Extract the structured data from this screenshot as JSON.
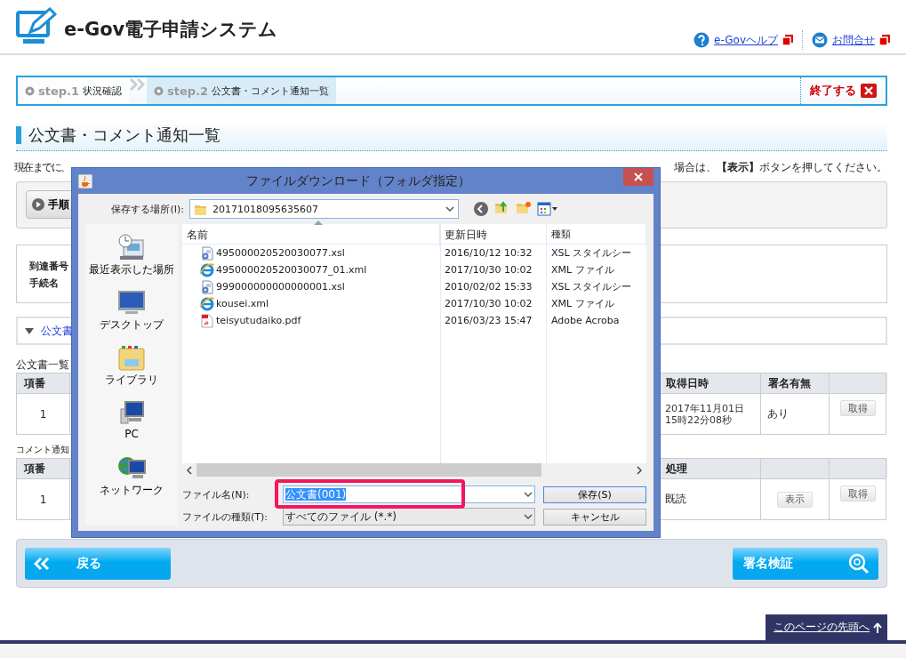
{
  "header": {
    "title": "e-Gov電子申請システム",
    "links": [
      {
        "label": "e-Govヘルプ",
        "kind": "help"
      },
      {
        "label": "お問合せ",
        "kind": "mail"
      }
    ]
  },
  "steps": [
    {
      "step": "step.1",
      "label": "状況確認",
      "selected": false
    },
    {
      "step": "step.2",
      "label": "公文書・コメント通知一覧",
      "selected": true
    }
  ],
  "exit_button": "終了する",
  "heading": "公文書・コメント通知一覧",
  "instruction": {
    "start": "現在までに、",
    "end": "場合は、**【表示】**ボタンを押してください。"
  },
  "procedure_button": "手順",
  "info_labels": [
    "到達番号",
    "手続名"
  ],
  "section_link": "公文書",
  "documents": {
    "caption": "公文書一覧",
    "columns": [
      "項番",
      "取得日時",
      "署名有無"
    ],
    "rows": [
      {
        "index": "1",
        "acquired": [
          "2017年11月01日",
          "15時22分08秒"
        ],
        "signed": "あり",
        "action": "取得"
      }
    ]
  },
  "comments": {
    "caption": "コメント通知",
    "columns": [
      "項番",
      "処理"
    ],
    "rows": [
      {
        "index": "1",
        "status": "既読",
        "view": "表示",
        "action": "取得"
      }
    ]
  },
  "back_button": "戻る",
  "verify_button": "署名検証",
  "page_top": "このページの先頭へ",
  "dialog": {
    "title": "ファイルダウンロード（フォルダ指定）",
    "location_label": "保存する場所(I):",
    "location": "20171018095635607",
    "places": [
      {
        "label": "最近表示した場所",
        "kind": "recent"
      },
      {
        "label": "デスクトップ",
        "kind": "desktop"
      },
      {
        "label": "ライブラリ",
        "kind": "library"
      },
      {
        "label": "PC",
        "kind": "pc"
      },
      {
        "label": "ネットワーク",
        "kind": "network"
      }
    ],
    "columns": [
      "名前",
      "更新日時",
      "種類"
    ],
    "files": [
      {
        "name": "495000020520030077.xsl",
        "modified": "2016/10/12 10:32",
        "type": "XSL スタイルシー",
        "kind": "xsl"
      },
      {
        "name": "495000020520030077_01.xml",
        "modified": "2017/10/30 10:02",
        "type": "XML ファイル",
        "kind": "xml"
      },
      {
        "name": "999000000000000001.xsl",
        "modified": "2010/02/02 15:33",
        "type": "XSL スタイルシー",
        "kind": "xsl"
      },
      {
        "name": "kousei.xml",
        "modified": "2017/10/30 10:02",
        "type": "XML ファイル",
        "kind": "xml"
      },
      {
        "name": "teisyutudaiko.pdf",
        "modified": "2016/03/23 15:47",
        "type": "Adobe Acroba",
        "kind": "pdf"
      }
    ],
    "filename_label": "ファイル名(N):",
    "filename": "公文書(001)",
    "filetype_label": "ファイルの種類(T):",
    "filetype": "すべてのファイル (*.*)",
    "save_button": "保存(S)",
    "cancel_button": "キャンセル",
    "highlighted": true
  }
}
